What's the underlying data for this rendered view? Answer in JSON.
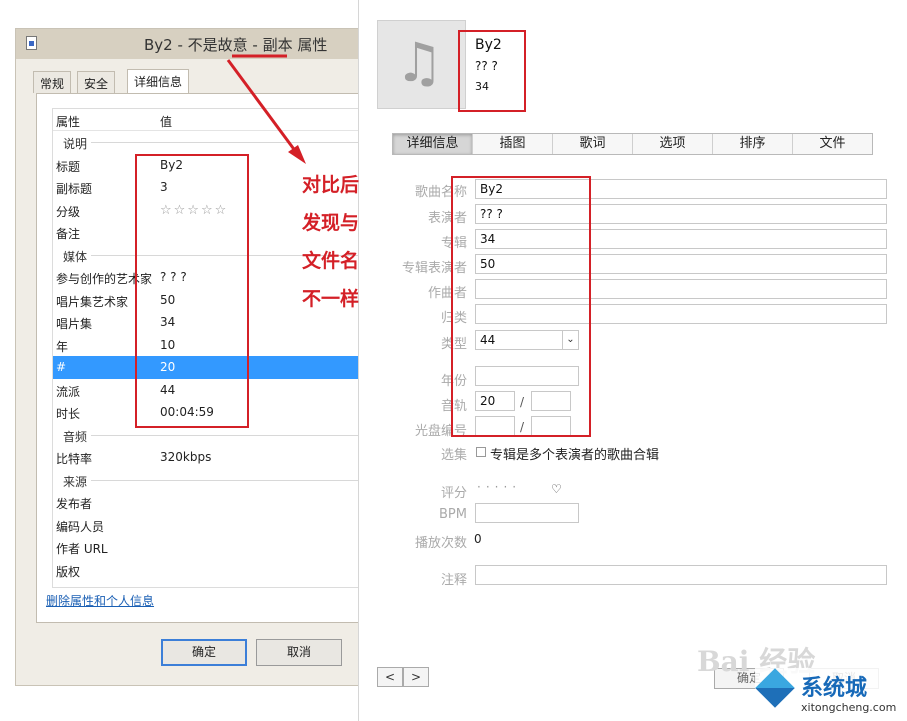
{
  "left_dialog": {
    "title": "By2 - 不是故意 - 副本 属性",
    "tabs": [
      "常规",
      "安全",
      "详细信息"
    ],
    "columns": {
      "property": "属性",
      "value": "值"
    },
    "sections": {
      "description": "说明",
      "media": "媒体",
      "audio": "音频",
      "origin": "来源"
    },
    "rows": {
      "title": {
        "k": "标题",
        "v": "By2"
      },
      "subtitle": {
        "k": "副标题",
        "v": "3"
      },
      "rating": {
        "k": "分级",
        "stars": "☆☆☆☆☆"
      },
      "comments": {
        "k": "备注",
        "v": ""
      },
      "contributing_artist": {
        "k": "参与创作的艺术家",
        "v": "? ? ?"
      },
      "album_artist": {
        "k": "唱片集艺术家",
        "v": "50"
      },
      "album": {
        "k": "唱片集",
        "v": "34"
      },
      "year": {
        "k": "年",
        "v": "10"
      },
      "track": {
        "k": "#",
        "v": "20"
      },
      "genre": {
        "k": "流派",
        "v": "44"
      },
      "length": {
        "k": "时长",
        "v": "00:04:59"
      },
      "bitrate": {
        "k": "比特率",
        "v": "320kbps"
      },
      "publisher": {
        "k": "发布者"
      },
      "encoded_by": {
        "k": "编码人员"
      },
      "author_url": {
        "k": "作者 URL"
      },
      "copyright": {
        "k": "版权"
      }
    },
    "remove_link": "删除属性和个人信息",
    "ok_button": "确定",
    "cancel_button": "取消"
  },
  "annotation": {
    "lines": [
      "对比后",
      "发现与",
      "文件名",
      "不一样"
    ],
    "color": "#d42027"
  },
  "right_dialog": {
    "header": {
      "title": "By2",
      "artist": "?? ?",
      "album": "34"
    },
    "tabs": [
      "详细信息",
      "插图",
      "歌词",
      "选项",
      "排序",
      "文件"
    ],
    "active_tab": "详细信息",
    "fields": {
      "song_name": {
        "label": "歌曲名称",
        "value": "By2"
      },
      "artist": {
        "label": "表演者",
        "value": "?? ?"
      },
      "album": {
        "label": "专辑",
        "value": "34"
      },
      "album_artist": {
        "label": "专辑表演者",
        "value": "50"
      },
      "composer": {
        "label": "作曲者",
        "value": ""
      },
      "grouping": {
        "label": "归类",
        "value": ""
      },
      "genre": {
        "label": "类型",
        "value": "44"
      },
      "year": {
        "label": "年份",
        "value": ""
      },
      "track": {
        "label": "音轨",
        "value": "20",
        "of": ""
      },
      "disc": {
        "label": "光盘编号",
        "value": "",
        "of": ""
      },
      "compilation": {
        "label": "选集",
        "text": "专辑是多个表演者的歌曲合辑"
      },
      "rating": {
        "label": "评分",
        "dots": "·····",
        "heart": "♡"
      },
      "bpm": {
        "label": "BPM",
        "value": ""
      },
      "play_count": {
        "label": "播放次数",
        "value": "0"
      },
      "comments": {
        "label": "注释",
        "value": ""
      }
    },
    "nav": {
      "prev": "<",
      "next": ">"
    },
    "ok_button": "确定",
    "cancel_button": "取消"
  },
  "watermark": {
    "baidu": "Bai 经验",
    "brand_name": "系统城",
    "brand_url": "xitongcheng.com"
  }
}
